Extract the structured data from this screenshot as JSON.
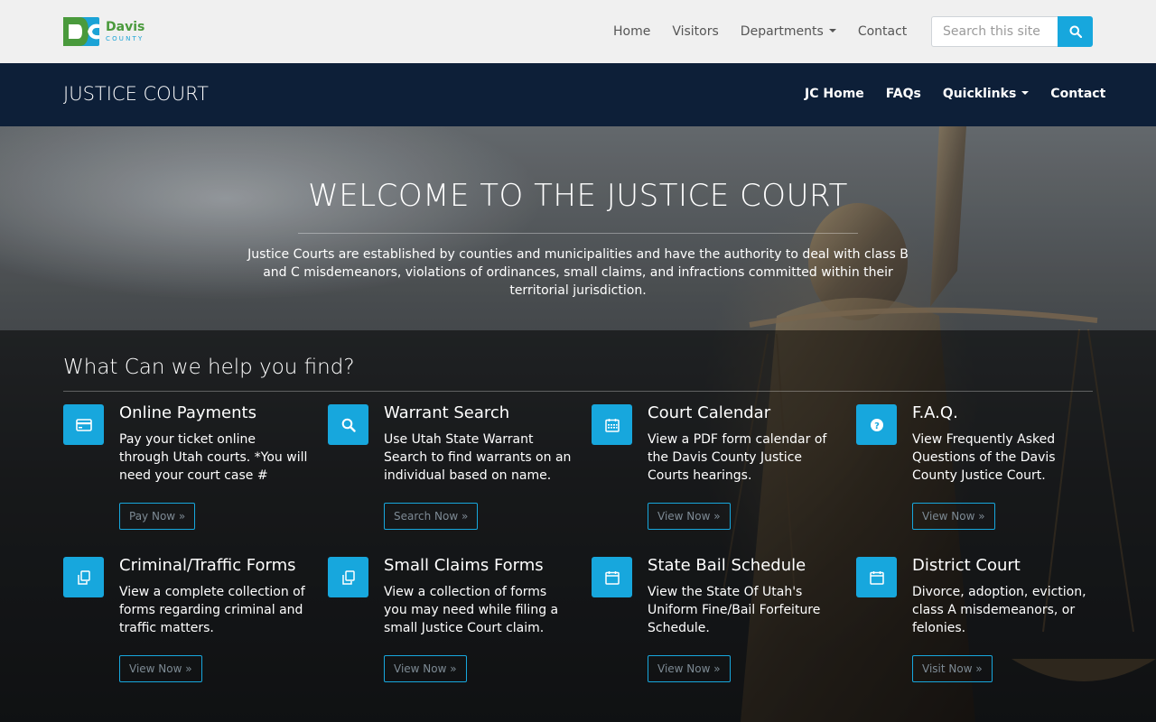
{
  "site": {
    "logo_name": "Davis",
    "logo_sub": "COUNTY",
    "nav": [
      {
        "label": "Home"
      },
      {
        "label": "Visitors"
      },
      {
        "label": "Departments"
      },
      {
        "label": "Contact"
      }
    ],
    "search_placeholder": "Search this site"
  },
  "department": {
    "title": "JUSTICE COURT",
    "nav": [
      {
        "label": "JC Home"
      },
      {
        "label": "FAQs"
      },
      {
        "label": "Quicklinks"
      },
      {
        "label": "Contact"
      }
    ]
  },
  "hero": {
    "title": "WELCOME TO THE JUSTICE COURT",
    "text": "Justice Courts are established by counties and municipalities and have the authority to deal with class B and C misdemeanors, violations of ordinances, small claims, and infractions committed within their territorial jurisdiction."
  },
  "help": {
    "title": "What Can we help you find?",
    "cards": [
      {
        "icon": "credit-card-icon",
        "title": "Online Payments",
        "desc": "Pay your ticket online through Utah courts. *You will need your court case #",
        "button": "Pay Now »"
      },
      {
        "icon": "search-icon",
        "title": "Warrant Search",
        "desc": "Use Utah State Warrant Search to find warrants on an individual based on name.",
        "button": "Search Now »"
      },
      {
        "icon": "calendar-grid-icon",
        "title": "Court Calendar",
        "desc": "View a PDF form calendar of the Davis County Justice Courts hearings.",
        "button": "View Now »"
      },
      {
        "icon": "question-circle-icon",
        "title": "F.A.Q.",
        "desc": "View Frequently Asked Questions of the Davis County Justice Court.",
        "button": "View Now »"
      },
      {
        "icon": "copy-files-icon",
        "title": "Criminal/Traffic Forms",
        "desc": "View a complete collection of forms regarding criminal and traffic matters.",
        "button": "View Now »"
      },
      {
        "icon": "copy-files-icon",
        "title": "Small Claims Forms",
        "desc": "View a collection of forms you may need while filing a small Justice Court claim.",
        "button": "View Now »"
      },
      {
        "icon": "calendar-icon",
        "title": "State Bail Schedule",
        "desc": "View the State Of Utah's Uniform Fine/Bail Forfeiture Schedule.",
        "button": "View Now »"
      },
      {
        "icon": "calendar-icon",
        "title": "District Court",
        "desc": "Divorce, adoption, eviction, class A misdemeanors, or felonies.",
        "button": "Visit Now »"
      }
    ]
  },
  "colors": {
    "accent": "#17a7dd",
    "dept_bar": "#0d1f38",
    "topbar": "#f0f0f0"
  }
}
